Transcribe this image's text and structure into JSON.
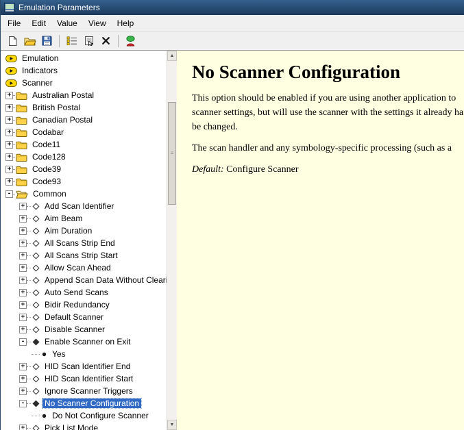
{
  "window": {
    "title": "Emulation Parameters",
    "app_icon": "app-icon",
    "menus": [
      "File",
      "Edit",
      "Value",
      "View",
      "Help"
    ]
  },
  "toolbar": {
    "items": [
      {
        "type": "button",
        "name": "new-button",
        "icon": "new-page-icon"
      },
      {
        "type": "button",
        "name": "open-button",
        "icon": "open-folder-icon"
      },
      {
        "type": "button",
        "name": "save-button",
        "icon": "save-icon"
      },
      {
        "type": "separator"
      },
      {
        "type": "button",
        "name": "list-view-button",
        "icon": "list-icon"
      },
      {
        "type": "button",
        "name": "properties-button",
        "icon": "properties-icon"
      },
      {
        "type": "button",
        "name": "delete-button",
        "icon": "delete-icon"
      },
      {
        "type": "separator"
      },
      {
        "type": "button",
        "name": "status-button",
        "icon": "status-indicator-icon"
      }
    ]
  },
  "tree": {
    "items": [
      {
        "label": "Emulation",
        "type": "root"
      },
      {
        "label": "Indicators",
        "type": "root"
      },
      {
        "label": "Scanner",
        "type": "root"
      },
      {
        "label": "Australian Postal",
        "type": "folder"
      },
      {
        "label": "British Postal",
        "type": "folder"
      },
      {
        "label": "Canadian Postal",
        "type": "folder"
      },
      {
        "label": "Codabar",
        "type": "folder"
      },
      {
        "label": "Code11",
        "type": "folder"
      },
      {
        "label": "Code128",
        "type": "folder"
      },
      {
        "label": "Code39",
        "type": "folder"
      },
      {
        "label": "Code93",
        "type": "folder"
      },
      {
        "label": "Common",
        "type": "folder-open"
      },
      {
        "label": "Add Scan Identifier",
        "type": "param"
      },
      {
        "label": "Aim Beam",
        "type": "param"
      },
      {
        "label": "Aim Duration",
        "type": "param"
      },
      {
        "label": "All Scans Strip End",
        "type": "param"
      },
      {
        "label": "All Scans Strip Start",
        "type": "param"
      },
      {
        "label": "Allow Scan Ahead",
        "type": "param"
      },
      {
        "label": "Append Scan Data Without Cleari",
        "type": "param"
      },
      {
        "label": "Auto Send Scans",
        "type": "param"
      },
      {
        "label": "Bidir Redundancy",
        "type": "param"
      },
      {
        "label": "Default Scanner",
        "type": "param"
      },
      {
        "label": "Disable Scanner",
        "type": "param"
      },
      {
        "label": "Enable Scanner on Exit",
        "type": "param-open"
      },
      {
        "label": "Yes",
        "type": "value"
      },
      {
        "label": "HID Scan Identifier End",
        "type": "param"
      },
      {
        "label": "HID Scan Identifier Start",
        "type": "param"
      },
      {
        "label": "Ignore Scanner Triggers",
        "type": "param"
      },
      {
        "label": "No Scanner Configuration",
        "type": "param-open",
        "selected": true
      },
      {
        "label": "Do Not Configure Scanner",
        "type": "value"
      },
      {
        "label": "Pick List Mode",
        "type": "param"
      }
    ]
  },
  "content": {
    "title": "No Scanner Configuration",
    "paragraphs": [
      {
        "lines": [
          "This option should be enabled if you are using another application to",
          "scanner settings, but will use the scanner with the settings it already ha",
          "be changed."
        ]
      },
      {
        "lines": [
          "The scan handler and any symbology-specific processing (such as a"
        ]
      }
    ],
    "default_label": "Default:",
    "default_value": "Configure Scanner"
  },
  "colors": {
    "titlebar": "#1c3a5c",
    "selection": "#316ac5",
    "panel_background": "#ffffe1"
  }
}
